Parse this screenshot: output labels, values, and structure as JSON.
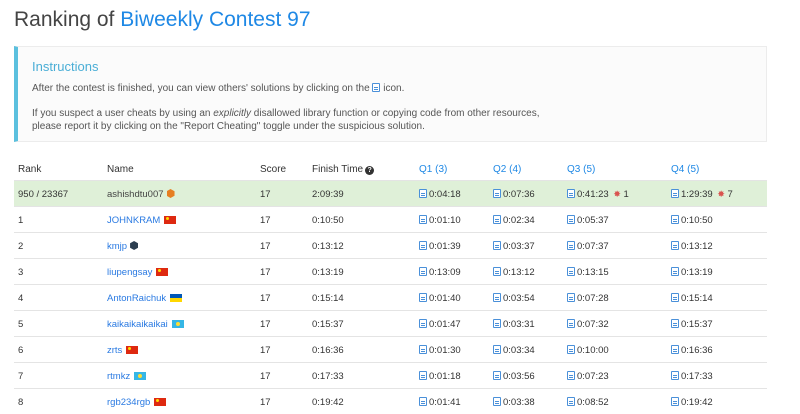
{
  "title": {
    "prefix": "Ranking of",
    "contest": "Biweekly Contest 97"
  },
  "instructions": {
    "heading": "Instructions",
    "line1_before": "After the contest is finished, you can view others' solutions by clicking on the",
    "line1_after": "icon.",
    "line2_before": "If you suspect a user cheats by using an",
    "line2_em": "explicitly",
    "line2_after": "disallowed library function or copying code from other resources,",
    "line3": "please report it by clicking on the \"Report Cheating\" toggle under the suspicious solution."
  },
  "headers": {
    "rank": "Rank",
    "name": "Name",
    "score": "Score",
    "finish_time": "Finish Time",
    "q1": "Q1 (3)",
    "q2": "Q2 (4)",
    "q3": "Q3 (5)",
    "q4": "Q4 (5)"
  },
  "rows": [
    {
      "rank": "950 / 23367",
      "name": "ashishdtu007",
      "badge": "hex",
      "badge_color": "#e67e22",
      "score": "17",
      "finish_time": "2:09:39",
      "q1": "0:04:18",
      "q2": "0:07:36",
      "q3": "0:41:23",
      "q3_penalty": "1",
      "q4": "1:29:39",
      "q4_penalty": "7",
      "current_user": true
    },
    {
      "rank": "1",
      "name": "JOHNKRAM",
      "badge": "flag-cn",
      "score": "17",
      "finish_time": "0:10:50",
      "q1": "0:01:10",
      "q2": "0:02:34",
      "q3": "0:05:37",
      "q4": "0:10:50"
    },
    {
      "rank": "2",
      "name": "kmjp",
      "badge": "hex",
      "badge_color": "#2c3e50",
      "score": "17",
      "finish_time": "0:13:12",
      "q1": "0:01:39",
      "q2": "0:03:37",
      "q3": "0:07:37",
      "q4": "0:13:12"
    },
    {
      "rank": "3",
      "name": "liupengsay",
      "badge": "flag-cn",
      "score": "17",
      "finish_time": "0:13:19",
      "q1": "0:13:09",
      "q2": "0:13:12",
      "q3": "0:13:15",
      "q4": "0:13:19"
    },
    {
      "rank": "4",
      "name": "AntonRaichuk",
      "badge": "flag-ua",
      "score": "17",
      "finish_time": "0:15:14",
      "q1": "0:01:40",
      "q2": "0:03:54",
      "q3": "0:07:28",
      "q4": "0:15:14"
    },
    {
      "rank": "5",
      "name": "kaikaikaikaikai",
      "badge": "flag-kz",
      "score": "17",
      "finish_time": "0:15:37",
      "q1": "0:01:47",
      "q2": "0:03:31",
      "q3": "0:07:32",
      "q4": "0:15:37"
    },
    {
      "rank": "6",
      "name": "zrts",
      "badge": "flag-cn",
      "score": "17",
      "finish_time": "0:16:36",
      "q1": "0:01:30",
      "q2": "0:03:34",
      "q3": "0:10:00",
      "q4": "0:16:36"
    },
    {
      "rank": "7",
      "name": "rtmkz",
      "badge": "flag-kz",
      "score": "17",
      "finish_time": "0:17:33",
      "q1": "0:01:18",
      "q2": "0:03:56",
      "q3": "0:07:23",
      "q4": "0:17:33"
    },
    {
      "rank": "8",
      "name": "rgb234rgb",
      "badge": "flag-cn",
      "score": "17",
      "finish_time": "0:19:42",
      "q1": "0:01:41",
      "q2": "0:03:38",
      "q3": "0:08:52",
      "q4": "0:19:42"
    }
  ],
  "colors": {
    "accent": "#1e88e5",
    "info": "#5bc0de",
    "highlight_row": "#dff0d8",
    "penalty": "#d9534f"
  }
}
